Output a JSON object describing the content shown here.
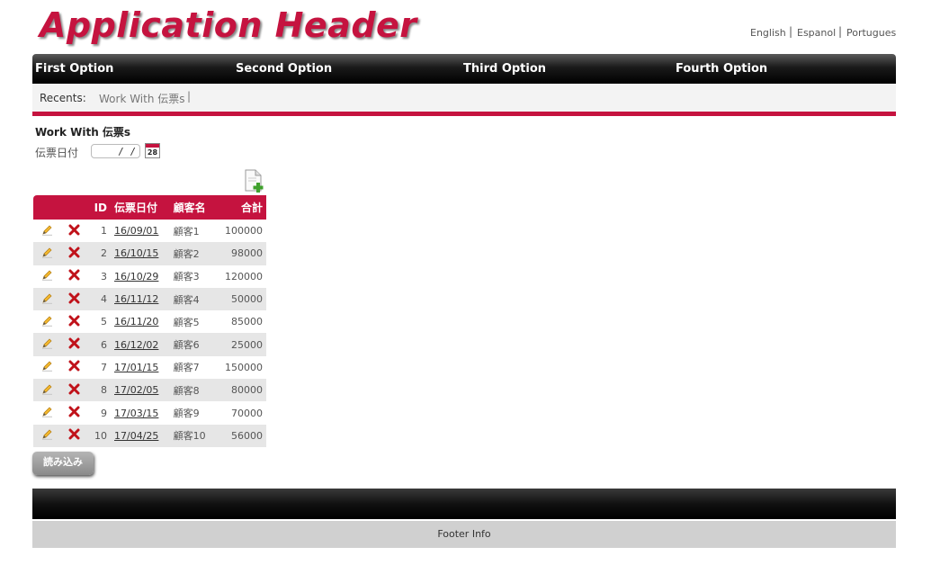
{
  "header": {
    "title": "Application Header"
  },
  "languages": [
    "English",
    "Espanol",
    "Portugues"
  ],
  "menu": [
    "First Option",
    "Second Option",
    "Third Option",
    "Fourth Option"
  ],
  "recents": {
    "label": "Recents:",
    "items": [
      "Work With 伝票s"
    ],
    "separator": "|"
  },
  "page": {
    "title": "Work With 伝票s"
  },
  "filter": {
    "label": "伝票日付",
    "date_value": "/ /",
    "calendar_day": "28"
  },
  "grid": {
    "columns": [
      "ID",
      "伝票日付",
      "顧客名",
      "合計"
    ],
    "rows": [
      {
        "id": "1",
        "date": "16/09/01",
        "customer": "顧客1",
        "total": "100000"
      },
      {
        "id": "2",
        "date": "16/10/15",
        "customer": "顧客2",
        "total": "98000"
      },
      {
        "id": "3",
        "date": "16/10/29",
        "customer": "顧客3",
        "total": "120000"
      },
      {
        "id": "4",
        "date": "16/11/12",
        "customer": "顧客4",
        "total": "50000"
      },
      {
        "id": "5",
        "date": "16/11/20",
        "customer": "顧客5",
        "total": "85000"
      },
      {
        "id": "6",
        "date": "16/12/02",
        "customer": "顧客6",
        "total": "25000"
      },
      {
        "id": "7",
        "date": "17/01/15",
        "customer": "顧客7",
        "total": "150000"
      },
      {
        "id": "8",
        "date": "17/02/05",
        "customer": "顧客8",
        "total": "80000"
      },
      {
        "id": "9",
        "date": "17/03/15",
        "customer": "顧客9",
        "total": "70000"
      },
      {
        "id": "10",
        "date": "17/04/25",
        "customer": "顧客10",
        "total": "56000"
      }
    ]
  },
  "buttons": {
    "load": "読み込み"
  },
  "footer": {
    "info": "Footer Info"
  },
  "colors": {
    "accent": "#c5133f",
    "menubar": "#000000",
    "footer_info_bg": "#d0d0d0"
  },
  "icons": {
    "edit": "pencil-icon",
    "delete": "delete-x-icon",
    "add": "add-document-icon",
    "calendar": "calendar-icon"
  }
}
